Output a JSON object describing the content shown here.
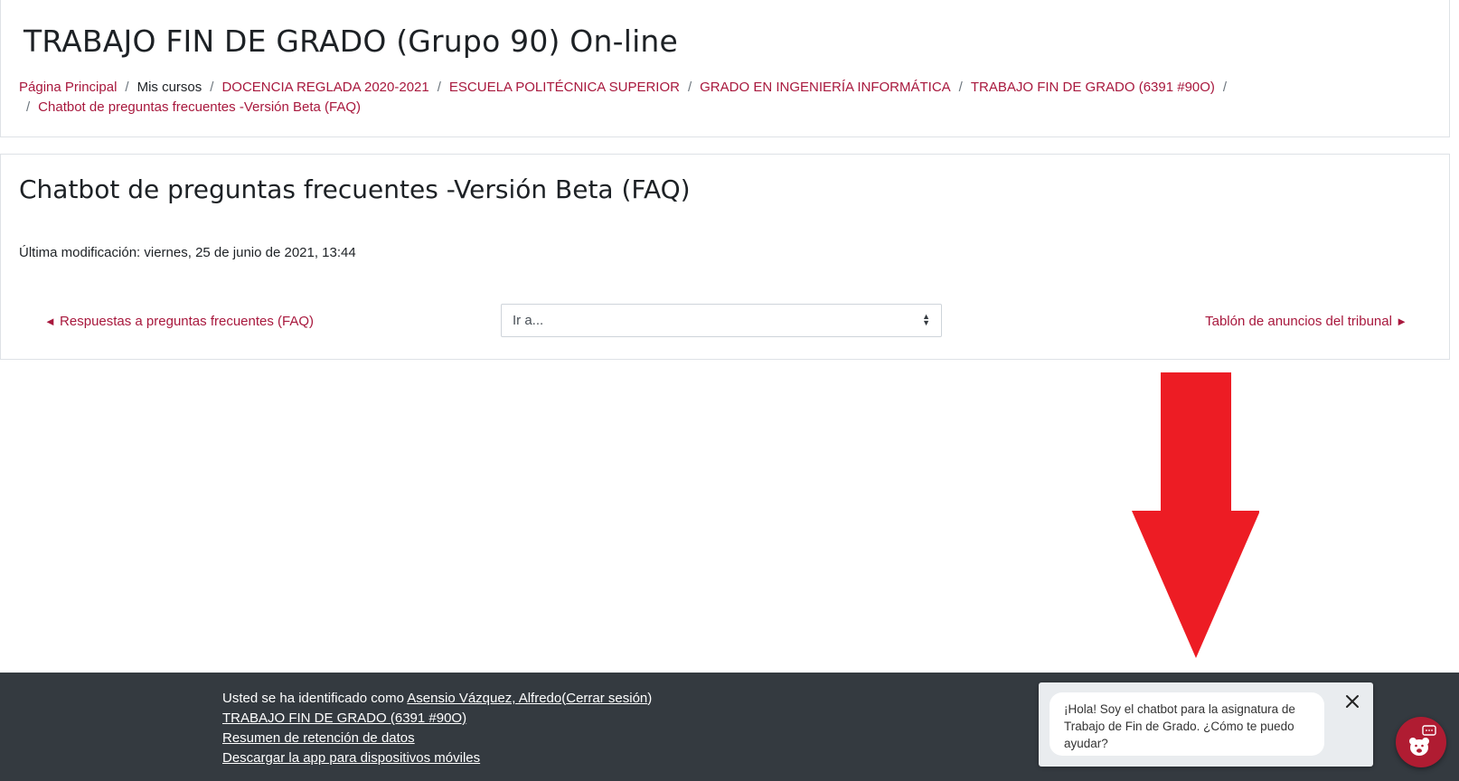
{
  "course": {
    "title": "TRABAJO FIN DE GRADO (Grupo 90) On-line"
  },
  "breadcrumb": {
    "items": [
      {
        "label": "Página Principal",
        "link": true
      },
      {
        "label": "Mis cursos",
        "link": false
      },
      {
        "label": "DOCENCIA REGLADA 2020-2021",
        "link": true
      },
      {
        "label": "ESCUELA POLITÉCNICA SUPERIOR",
        "link": true
      },
      {
        "label": "GRADO EN INGENIERÍA INFORMÁTICA",
        "link": true
      },
      {
        "label": "TRABAJO FIN DE GRADO (6391 #90O)",
        "link": true
      },
      {
        "label": "Chatbot de preguntas frecuentes -Versión Beta (FAQ)",
        "link": true
      }
    ],
    "separator": "/"
  },
  "page": {
    "title": "Chatbot de preguntas frecuentes -Versión Beta (FAQ)",
    "modified": "Última modificación: viernes, 25 de junio de 2021, 13:44"
  },
  "navigation": {
    "prev_label": "Respuestas a preguntas frecuentes (FAQ)",
    "next_label": "Tablón de anuncios del tribunal",
    "jump_selected": "Ir a..."
  },
  "footer": {
    "logged_in_prefix": "Usted se ha identificado como ",
    "user_name": "Asensio Vázquez, Alfredo",
    "logout_label": "Cerrar sesión",
    "course_link": "TRABAJO FIN DE GRADO (6391 #90O)",
    "data_retention": "Resumen de retención de datos",
    "mobile_app": "Descargar la app para dispositivos móviles"
  },
  "chatbot": {
    "greeting": "¡Hola! Soy el chatbot para la asignatura de Trabajo de Fin de Grado. ¿Cómo te puedo ayudar?"
  },
  "colors": {
    "link": "#a8183d",
    "footer_bg": "#343a40",
    "arrow": "#ed1c24",
    "launcher": "#b01c32"
  }
}
